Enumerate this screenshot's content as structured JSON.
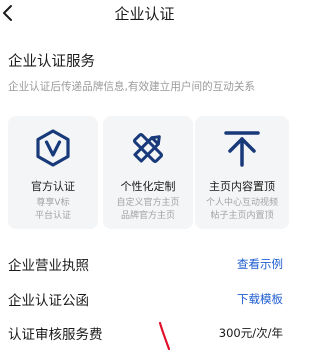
{
  "header": {
    "title": "企业认证"
  },
  "service": {
    "title": "企业认证服务",
    "description": "企业认证后传递品牌信息,有效建立用户间的互动关系"
  },
  "cards": [
    {
      "icon": "official-verify-v-icon",
      "title": "官方认证",
      "sub1": "尊享V标",
      "sub2": "平台认证"
    },
    {
      "icon": "customize-pencil-ruler-icon",
      "title": "个性化定制",
      "sub1": "自定义官方主页",
      "sub2": "品牌官方主页"
    },
    {
      "icon": "pin-to-top-icon",
      "title": "主页内容置顶",
      "sub1": "个人中心互动视频",
      "sub2": "帖子主页内置顶"
    }
  ],
  "rows": {
    "license": {
      "label": "企业营业执照",
      "action": "查看示例"
    },
    "letter": {
      "label": "企业认证公函",
      "action": "下载模板"
    },
    "fee": {
      "label": "认证审核服务费",
      "value": "300元/次/年"
    }
  },
  "colors": {
    "accent": "#1f5fd1",
    "icon": "#183a7a",
    "annotation": "#e0102a"
  }
}
